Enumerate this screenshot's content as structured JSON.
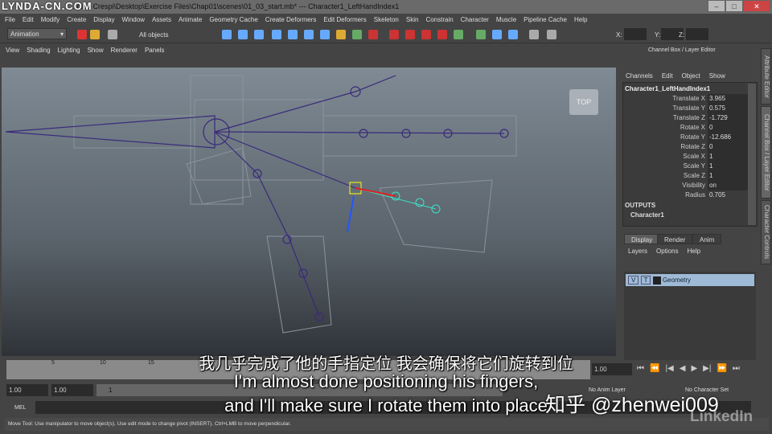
{
  "title": "Autodesk Maya 2015: C:\\Users\\Adam Crespi\\Desktop\\Exercise Files\\Chap01\\scenes\\01_03_start.mb* --- Character1_LeftHandIndex1",
  "title_visible": "...dam Crespi\\Desktop\\Exercise Files\\Chap01\\scenes\\01_03_start.mb*  ---  Character1_LeftHandIndex1",
  "watermark": "LYNDA-CN.COM",
  "menu": [
    "File",
    "Edit",
    "Modify",
    "Create",
    "Display",
    "Window",
    "Assets",
    "Animate",
    "Geometry Cache",
    "Create Deformers",
    "Edit Deformers",
    "Skeleton",
    "Skin",
    "Constrain",
    "Character",
    "Muscle",
    "Pipeline Cache",
    "Help"
  ],
  "shelf": {
    "mode": "Animation",
    "selection_mask": "All objects",
    "x_label": "X:",
    "y_label": "Y:",
    "z_label": "Z:"
  },
  "viewport": {
    "menu": [
      "View",
      "Shading",
      "Lighting",
      "Show",
      "Renderer",
      "Panels"
    ],
    "view_cube": "TOP"
  },
  "channel_box": {
    "title": "Channel Box / Layer Editor",
    "menu": [
      "Channels",
      "Edit",
      "Object",
      "Show"
    ],
    "object": "Character1_LeftHandIndex1",
    "channels": [
      {
        "label": "Translate X",
        "value": "3.965"
      },
      {
        "label": "Translate Y",
        "value": "0.575"
      },
      {
        "label": "Translate Z",
        "value": "-1.729"
      },
      {
        "label": "Rotate X",
        "value": "0"
      },
      {
        "label": "Rotate Y",
        "value": "-12.686"
      },
      {
        "label": "Rotate Z",
        "value": "0"
      },
      {
        "label": "Scale X",
        "value": "1"
      },
      {
        "label": "Scale Y",
        "value": "1"
      },
      {
        "label": "Scale Z",
        "value": "1"
      },
      {
        "label": "Visibility",
        "value": "on"
      }
    ],
    "radius_label": "Radius",
    "radius_value": "0.705",
    "outputs_label": "OUTPUTS",
    "output": "Character1"
  },
  "layer_editor": {
    "tabs": [
      "Display",
      "Render",
      "Anim"
    ],
    "menu": [
      "Layers",
      "Options",
      "Help"
    ],
    "layer": {
      "v": "V",
      "t": "T",
      "name": "Geometry"
    }
  },
  "side_tabs": [
    "Attribute Editor",
    "Channel Box / Layer Editor",
    "Character Controls"
  ],
  "timeline": {
    "ticks": [
      "5",
      "10",
      "15"
    ],
    "current": "1.00"
  },
  "range": {
    "start": "1.00",
    "start2": "1.00",
    "slider_start": "1",
    "anim_layer": "No Anim Layer",
    "char_set": "No Character Set"
  },
  "mel": {
    "label": "MEL"
  },
  "help_line": "Move Tool: Use manipulator to move object(s). Use edit mode to change pivot (INSERT). Ctrl+LMB to move perpendicular.",
  "subtitles": {
    "zh": "我几乎完成了他的手指定位 我会确保将它们旋转到位",
    "en1": "I'm almost done positioning his fingers,",
    "en2": "and I'll make sure I rotate them into place"
  },
  "overlay": {
    "zhihu": "知乎 @zhenwei009",
    "brand": "LinkedIn"
  }
}
